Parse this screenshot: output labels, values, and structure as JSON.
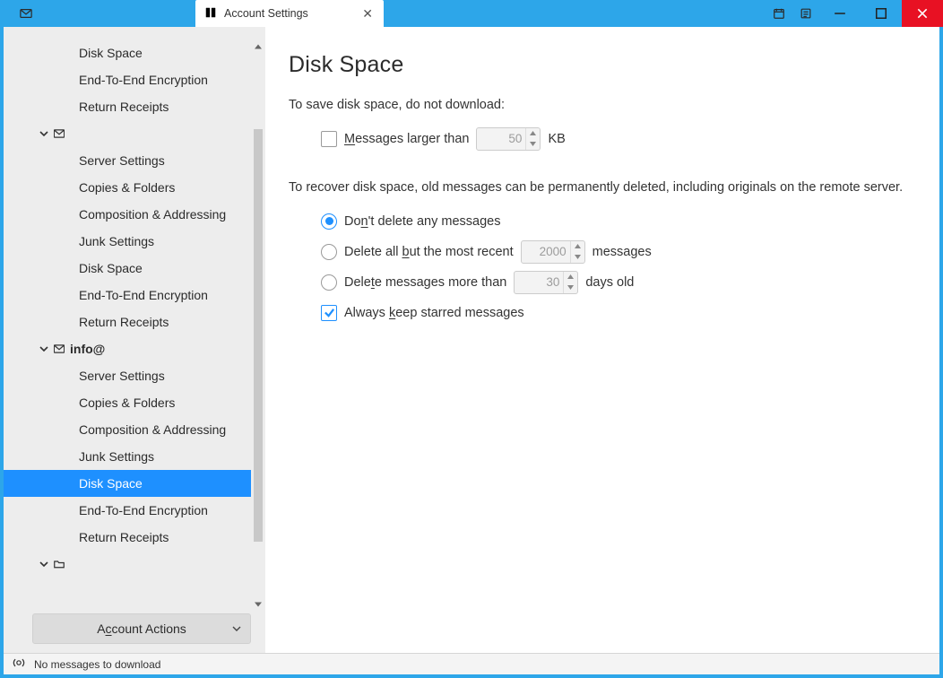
{
  "tab": {
    "label": "Account Settings"
  },
  "sidebar": {
    "section1": {
      "items": [
        "Disk Space",
        "End-To-End Encryption",
        "Return Receipts"
      ]
    },
    "account1": {
      "name": "",
      "items": [
        "Server Settings",
        "Copies & Folders",
        "Composition & Addressing",
        "Junk Settings",
        "Disk Space",
        "End-To-End Encryption",
        "Return Receipts"
      ]
    },
    "account2": {
      "name": "info@",
      "items": [
        "Server Settings",
        "Copies & Folders",
        "Composition & Addressing",
        "Junk Settings",
        "Disk Space",
        "End-To-End Encryption",
        "Return Receipts"
      ]
    },
    "account_actions_pre": "A",
    "account_actions_u": "c",
    "account_actions_post": "count Actions"
  },
  "content": {
    "heading": "Disk Space",
    "save_intro": "To save disk space, do not download:",
    "msg_larger_pre": "M",
    "msg_larger_post": "essages larger than",
    "size_value": "50",
    "size_unit": "KB",
    "recover_intro": "To recover disk space, old messages can be permanently deleted, including originals on the remote server.",
    "opt1_pre": "Do",
    "opt1_u": "n",
    "opt1_post": "'t delete any messages",
    "opt2_pre": "Delete all ",
    "opt2_u": "b",
    "opt2_post": "ut the most recent",
    "opt2_value": "2000",
    "opt2_suffix": "messages",
    "opt3_pre": "Dele",
    "opt3_u": "t",
    "opt3_post": "e messages more than",
    "opt3_value": "30",
    "opt3_suffix": "days old",
    "opt4_pre": "Always ",
    "opt4_u": "k",
    "opt4_post": "eep starred messages"
  },
  "statusbar": {
    "text": "No messages to download"
  }
}
